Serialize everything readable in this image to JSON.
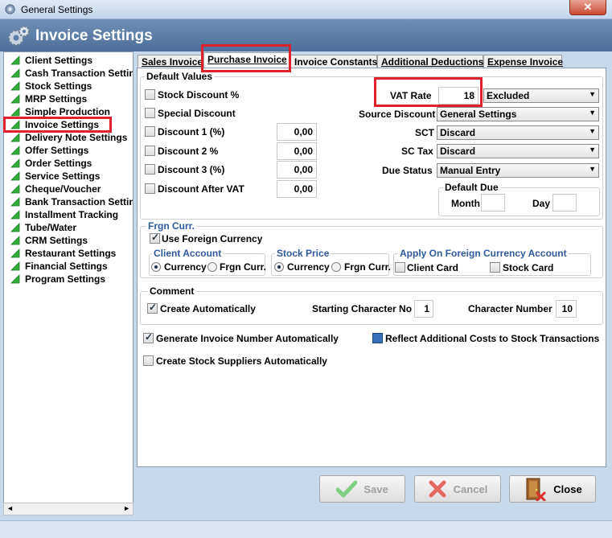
{
  "window": {
    "title": "General Settings",
    "close_glyph": "✕"
  },
  "header": {
    "title": "Invoice Settings",
    "icon": "gear-icon"
  },
  "sidebar": {
    "items": [
      {
        "label": "Client Settings"
      },
      {
        "label": "Cash Transaction Settings"
      },
      {
        "label": "Stock Settings"
      },
      {
        "label": "MRP Settings"
      },
      {
        "label": "Simple Production"
      },
      {
        "label": "Invoice Settings"
      },
      {
        "label": "Delivery Note Settings"
      },
      {
        "label": "Offer Settings"
      },
      {
        "label": "Order Settings"
      },
      {
        "label": "Service Settings"
      },
      {
        "label": "Cheque/Voucher"
      },
      {
        "label": "Bank Transaction Settings"
      },
      {
        "label": "Installment Tracking"
      },
      {
        "label": "Tube/Water"
      },
      {
        "label": "CRM Settings"
      },
      {
        "label": "Restaurant Settings"
      },
      {
        "label": "Financial Settings"
      },
      {
        "label": "Program Settings"
      }
    ],
    "scroll_left": "◄",
    "scroll_right": "►"
  },
  "tabs": [
    {
      "label": "Sales Invoice"
    },
    {
      "label": "Purchase Invoice"
    },
    {
      "label": "Invoice Constants"
    },
    {
      "label": "Additional Deductions"
    },
    {
      "label": "Expense Invoice"
    }
  ],
  "default_values": {
    "title": "Default Values",
    "stock_discount": "Stock Discount %",
    "special_discount": "Special Discount",
    "discount1": "Discount 1 (%)",
    "discount2": "Discount 2 %",
    "discount3": "Discount 3 (%)",
    "discount_after_vat": "Discount After VAT",
    "discount1_val": "0,00",
    "discount2_val": "0,00",
    "discount3_val": "0,00",
    "discount_after_vat_val": "0,00",
    "vat_rate_label": "VAT Rate",
    "vat_rate_val": "18",
    "vat_mode": "Excluded",
    "source_discount_label": "Source Discount",
    "source_discount_val": "General Settings",
    "sct_label": "SCT",
    "sct_val": "Discard",
    "sc_tax_label": "SC Tax",
    "sc_tax_val": "Discard",
    "due_status_label": "Due Status",
    "due_status_val": "Manual Entry",
    "default_due_title": "Default Due",
    "month_label": "Month",
    "day_label": "Day"
  },
  "foreign": {
    "title": "Frgn Curr.",
    "use_foreign": "Use Foreign Currency",
    "client_account_title": "Client Account",
    "stock_price_title": "Stock Price",
    "apply_title": "Apply On Foreign Currency Account",
    "currency": "Currency",
    "frgn_curr": "Frgn Curr.",
    "client_card": "Client Card",
    "stock_card": "Stock Card"
  },
  "comment": {
    "title": "Comment",
    "create_auto": "Create Automatically",
    "starting_char_label": "Starting Character No",
    "starting_char_val": "1",
    "char_number_label": "Character Number",
    "char_number_val": "10"
  },
  "options": {
    "gen_invoice_number": "Generate Invoice Number Automatically",
    "reflect_costs": "Reflect Additional Costs to Stock Transactions",
    "create_suppliers": "Create Stock Suppliers Automatically"
  },
  "buttons": {
    "save": "Save",
    "cancel": "Cancel",
    "close": "Close"
  },
  "colors": {
    "highlight": "#e0202a",
    "header": "#5a7ba6",
    "check_icon": "#2fae3a",
    "cancel_icon": "#d8322a"
  }
}
